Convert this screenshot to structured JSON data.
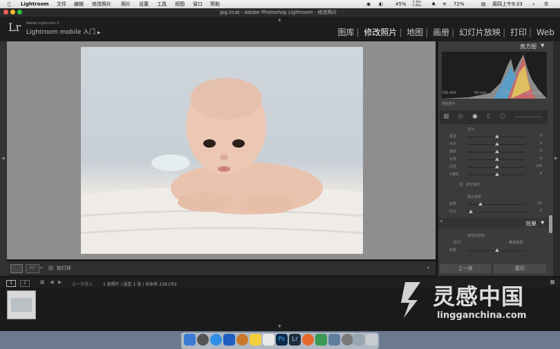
{
  "menubar": {
    "app": "Lightroom",
    "items": [
      "文件",
      "编辑",
      "修改照片",
      "照片",
      "设置",
      "工具",
      "视图",
      "窗口",
      "帮助"
    ],
    "status": {
      "battery": "45%",
      "net_up": "0.1K/s",
      "net_down": "0.4K/s",
      "power": "72%",
      "clock": "周四上午9:33"
    }
  },
  "window": {
    "title": "jpg.lrcat - Adobe Photoshop Lightroom - 修改照片"
  },
  "identity": {
    "logo": "Lr",
    "product": "Adobe Lightroom 5",
    "subtitle": "Lightroom mobile 入门"
  },
  "modules": [
    "图库",
    "修改照片",
    "地图",
    "画册",
    "幻灯片放映",
    "打印",
    "Web"
  ],
  "active_module": "修改照片",
  "right_panel": {
    "histogram_title": "直方图",
    "exif": {
      "iso": "ISO 400",
      "focal": "50 mm",
      "aperture": "f / 5.0",
      "shutter": "1/200 秒"
    },
    "original_photo": "原始照片",
    "section_label": "变换",
    "sliders": [
      {
        "label": "垂直",
        "value": "0"
      },
      {
        "label": "水平",
        "value": "0"
      },
      {
        "label": "旋转",
        "value": "0"
      },
      {
        "label": "长宽",
        "value": "0"
      },
      {
        "label": "比例",
        "value": "100"
      },
      {
        "label": "X偏移",
        "value": "0"
      }
    ],
    "lock_crop": "锁定裁剪",
    "lens_label": "镜头暗角",
    "vignette": [
      {
        "label": "数量",
        "value": "- 63"
      },
      {
        "label": "中点",
        "value": "5"
      }
    ],
    "effects_title": "效果",
    "post_vignette": "裁剪后暗角",
    "style_label": "样式：",
    "style_value": "高光优先：",
    "amount_label": "数量",
    "btn_prev": "上一张",
    "btn_reset": "复位"
  },
  "toolbar": {
    "proof": "软打样"
  },
  "filmbar": {
    "page1": "1",
    "page2": "2",
    "source": "上一次导入",
    "info": "1 张照片 / 选定 1 张 / 未命名-118.CR2"
  },
  "watermark": {
    "text": "灵感中国",
    "url": "lingganchina.com"
  }
}
